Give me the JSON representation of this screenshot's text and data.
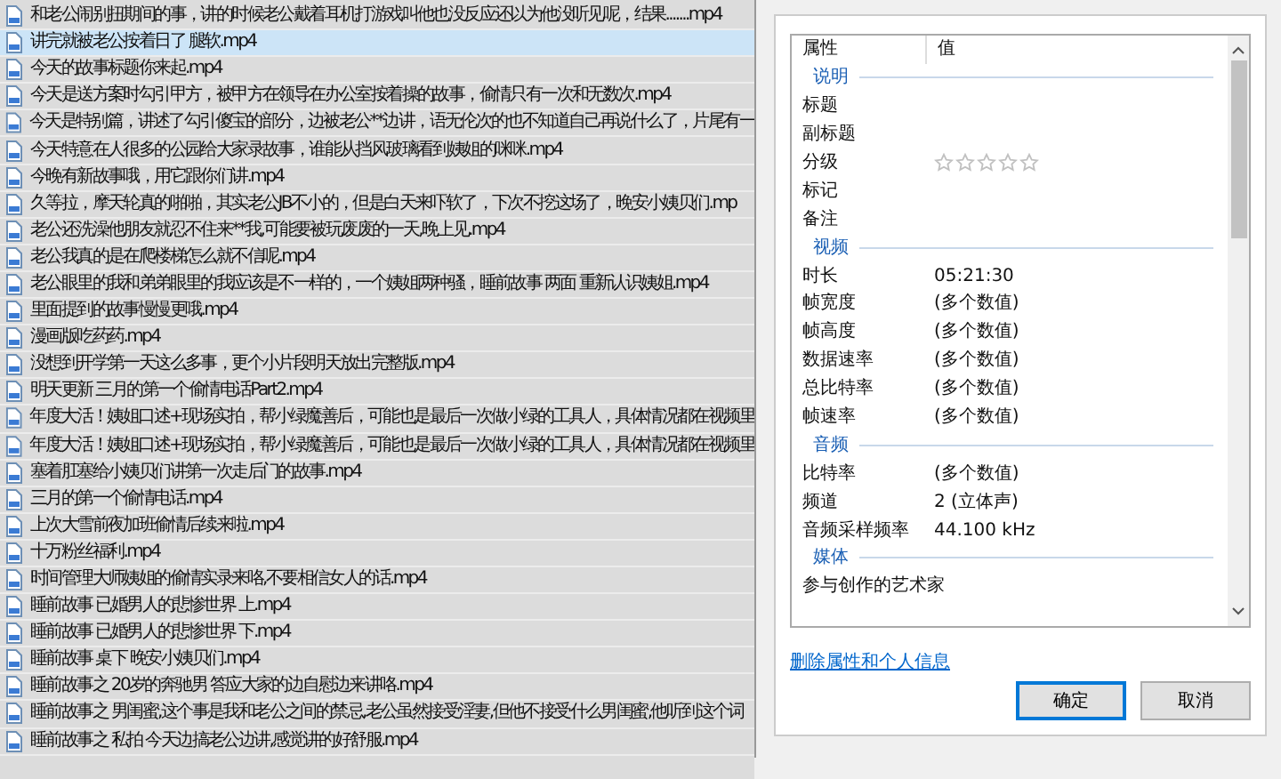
{
  "files": [
    {
      "name": "和老公闹别扭期间的事，讲的时候老公戴着耳机打游戏叫他也没反应还以为他没听见呢，结果.......mp4",
      "selected": false
    },
    {
      "name": "讲完就被老公按着日了 腿软.mp4",
      "selected": true
    },
    {
      "name": "今天的故事标题你来起.mp4",
      "selected": false
    },
    {
      "name": "今天是送方案时勾引甲方，被甲方在领导在办公室按着操的故事，偷情只有一次和无数次.mp4",
      "selected": false
    },
    {
      "name": "今天是特别篇，讲述了勾引傻宝的部分，边被老公**边讲，语无伦次的也不知道自己再说什么了，片尾有一",
      "selected": false
    },
    {
      "name": "今天特意在人很多的公园给大家录故事，谁能从挡风玻璃看到姨姐的咪咪.mp4",
      "selected": false
    },
    {
      "name": "今晚有新故事哦，用它跟你们讲.mp4",
      "selected": false
    },
    {
      "name": "久等拉，摩天轮真的啪啪，其实老公JB不小的，但是白天来吓软了，下次不挖这场了，晚安小姨贝们.mp",
      "selected": false
    },
    {
      "name": "老公还洗澡他朋友就忍不住来**我,可能要被玩废废的一天,晚上见.mp4",
      "selected": false
    },
    {
      "name": "老公我真的是在爬楼梯怎么就不信呢.mp4",
      "selected": false
    },
    {
      "name": "老公眼里的我和弟弟眼里的我应该是不一样的，一个姨姐两种骚，睡前故事 两面 重新认识姨姐.mp4",
      "selected": false
    },
    {
      "name": "里面提到的故事慢慢更哦.mp4",
      "selected": false
    },
    {
      "name": "漫画版吃药药.mp4",
      "selected": false
    },
    {
      "name": "没想到开学第一天这么多事，更个小片段明天放出完整版.mp4",
      "selected": false
    },
    {
      "name": "明天更新 三月的第一个偷情电话Part2.mp4",
      "selected": false
    },
    {
      "name": "年度大活！姨姐口述+现场实拍，帮小绿魔善后，可能也是最后一次做小绿的工具人，具体情况都在视频里",
      "selected": false
    },
    {
      "name": "年度大活！姨姐口述+现场实拍，帮小绿魔善后，可能也是最后一次做小绿的工具人，具体情况都在视频里",
      "selected": false
    },
    {
      "name": "塞着肛塞给小姨贝们讲第一次走后门的故事.mp4",
      "selected": false
    },
    {
      "name": "三月的第一个偷情电话.mp4",
      "selected": false
    },
    {
      "name": "上次大雪前夜加班偷情后续来啦.mp4",
      "selected": false
    },
    {
      "name": "十万粉丝福利.mp4",
      "selected": false
    },
    {
      "name": "时间管理大师姨姐的偷情实录来咯,不要相信女人的话.mp4",
      "selected": false
    },
    {
      "name": "睡前故事 已婚男人的悲惨世界 上.mp4",
      "selected": false
    },
    {
      "name": "睡前故事 已婚男人的悲惨世界 下.mp4",
      "selected": false
    },
    {
      "name": "睡前故事 桌下 晚安小姨贝们.mp4",
      "selected": false
    },
    {
      "name": "睡前故事之 20岁的奔驰男 答应大家的边自慰边来讲咯.mp4",
      "selected": false
    },
    {
      "name": "睡前故事之 男闺蜜,这个事是我和老公之间的禁忌,老公虽然接受淫妻,但他不接受什么男闺蜜,他听到这个词",
      "selected": false
    },
    {
      "name": "睡前故事之 私拍 今天边搞老公边讲,感觉讲的好舒服.mp4",
      "selected": false
    }
  ],
  "dialog": {
    "columns": [
      "属性",
      "值"
    ],
    "groups": [
      {
        "title": "说明",
        "rows": [
          {
            "name": "标题"
          },
          {
            "name": "副标题"
          },
          {
            "name": "分级",
            "kind": "stars",
            "stars": 0
          },
          {
            "name": "标记"
          },
          {
            "name": "备注"
          }
        ]
      },
      {
        "title": "视频",
        "rows": [
          {
            "name": "时长",
            "value": "05:21:30"
          },
          {
            "name": "帧宽度",
            "value": "(多个数值)"
          },
          {
            "name": "帧高度",
            "value": "(多个数值)"
          },
          {
            "name": "数据速率",
            "value": "(多个数值)"
          },
          {
            "name": "总比特率",
            "value": "(多个数值)"
          },
          {
            "name": "帧速率",
            "value": "(多个数值)"
          }
        ]
      },
      {
        "title": "音频",
        "rows": [
          {
            "name": "比特率",
            "value": "(多个数值)"
          },
          {
            "name": "频道",
            "value": "2 (立体声)"
          },
          {
            "name": "音频采样频率",
            "value": "44.100 kHz"
          }
        ]
      },
      {
        "title": "媒体",
        "rows": [
          {
            "name": "参与创作的艺术家"
          }
        ]
      }
    ],
    "link": "删除属性和个人信息",
    "buttons": [
      {
        "label": "确定",
        "default": true
      },
      {
        "label": "取消",
        "default": false
      }
    ]
  }
}
